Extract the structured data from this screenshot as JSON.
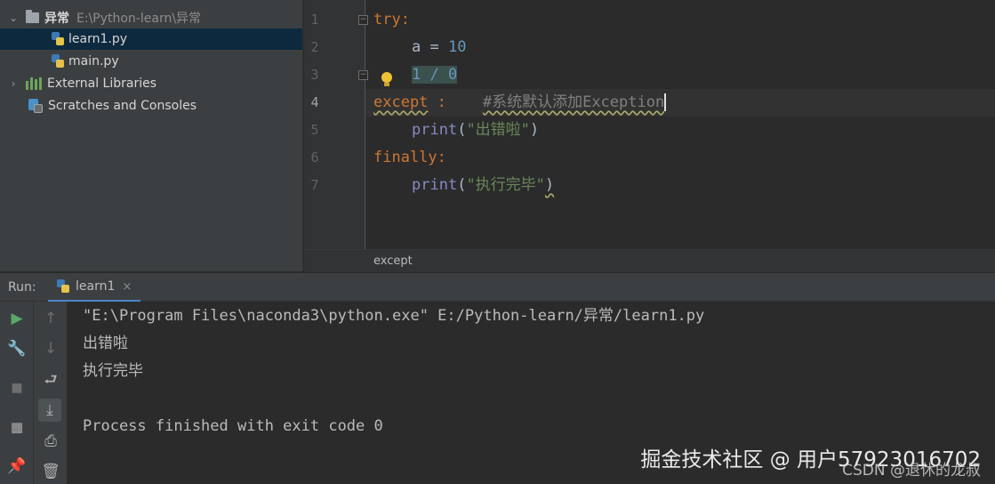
{
  "project": {
    "root": {
      "name": "异常",
      "path": "E:\\Python-learn\\异常"
    },
    "files": [
      "learn1.py",
      "main.py"
    ],
    "external_libraries": "External Libraries",
    "scratches": "Scratches and Consoles"
  },
  "editor": {
    "line_numbers": [
      "1",
      "2",
      "3",
      "4",
      "5",
      "6",
      "7"
    ],
    "code": {
      "l1_kw": "try",
      "l1_rest": ":",
      "l2_a": "a = ",
      "l2_num": "10",
      "l3_expr": "1 / 0",
      "l4_kw": "except",
      "l4_rest": " :    ",
      "l4_comment": "#系统默认添加Exception",
      "l5_fn": "print",
      "l5_open": "(",
      "l5_str": "\"出错啦\"",
      "l5_close": ")",
      "l6_kw": "finally",
      "l6_rest": ":",
      "l7_fn": "print",
      "l7_open": "(",
      "l7_str": "\"执行完毕\"",
      "l7_close": ")"
    },
    "breadcrumb": "except"
  },
  "run": {
    "label": "Run:",
    "tab": "learn1",
    "tab_close": "×",
    "output": [
      "\"E:\\Program Files\\naconda3\\python.exe\" E:/Python-learn/异常/learn1.py",
      "出错啦",
      "执行完毕",
      "",
      "Process finished with exit code 0"
    ]
  },
  "watermark": {
    "main": "掘金技术社区 @ 用户57923016702",
    "sub": "CSDN @退休的龙叔"
  },
  "colors": {
    "keyword": "#cc7832",
    "number": "#6897bb",
    "builtin": "#8888c6",
    "string": "#6a8759",
    "comment": "#808080"
  }
}
